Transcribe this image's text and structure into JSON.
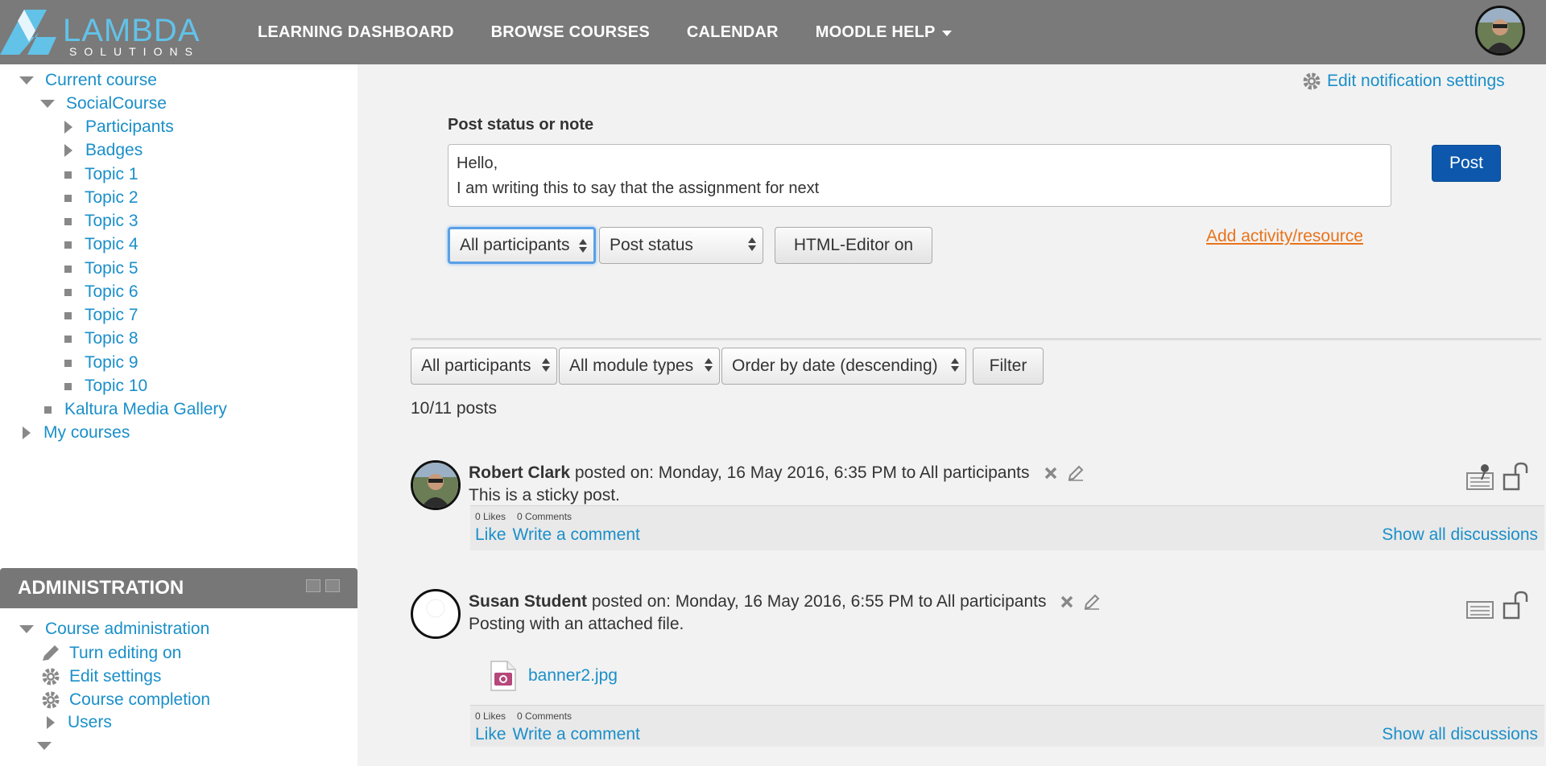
{
  "header": {
    "logo_word": "LAMBDA",
    "logo_sub": "SOLUTIONS",
    "nav": [
      {
        "label": "LEARNING DASHBOARD"
      },
      {
        "label": "BROWSE COURSES"
      },
      {
        "label": "CALENDAR"
      },
      {
        "label": "MOODLE HELP"
      }
    ]
  },
  "sidebar": {
    "current_course": "Current course",
    "course_name": "SocialCourse",
    "items": [
      {
        "label": "Participants"
      },
      {
        "label": "Badges"
      },
      {
        "label": "Topic 1"
      },
      {
        "label": "Topic 2"
      },
      {
        "label": "Topic 3"
      },
      {
        "label": "Topic 4"
      },
      {
        "label": "Topic 5"
      },
      {
        "label": "Topic 6"
      },
      {
        "label": "Topic 7"
      },
      {
        "label": "Topic 8"
      },
      {
        "label": "Topic 9"
      },
      {
        "label": "Topic 10"
      }
    ],
    "kaltura": "Kaltura Media Gallery",
    "my_courses": "My courses"
  },
  "admin": {
    "title": "ADMINISTRATION",
    "course_admin": "Course administration",
    "items": [
      {
        "label": "Turn editing on"
      },
      {
        "label": "Edit settings"
      },
      {
        "label": "Course completion"
      },
      {
        "label": "Users"
      }
    ]
  },
  "main": {
    "notification_link": "Edit notification settings",
    "post_label": "Post status or note",
    "post_text": "Hello,\nI am writing this to say that the assignment for next",
    "post_button": "Post",
    "audience_select": "All participants",
    "type_select": "Post status",
    "editor_button": "HTML-Editor on",
    "add_activity": "Add activity/resource",
    "filter": {
      "participants": "All participants",
      "modules": "All module types",
      "order": "Order by date (descending)",
      "button": "Filter"
    },
    "posts_count": "10/11 posts"
  },
  "posts": [
    {
      "author": "Robert Clark",
      "meta": "posted on: Monday, 16 May 2016, 6:35 PM to All participants",
      "body": "This is a sticky post.",
      "likes": "0 Likes",
      "comments": "0 Comments",
      "like_label": "Like",
      "comment_label": "Write a comment",
      "show_all": "Show all discussions"
    },
    {
      "author": "Susan Student",
      "meta": "posted on: Monday, 16 May 2016, 6:55 PM to All participants",
      "body": "Posting with an attached file.",
      "attachment": "banner2.jpg",
      "likes": "0 Likes",
      "comments": "0 Comments",
      "like_label": "Like",
      "comment_label": "Write a comment",
      "show_all": "Show all discussions"
    }
  ],
  "colors": {
    "header_bg": "#7a7a7a",
    "link": "#1a8fc9",
    "accent_orange": "#e8731a",
    "post_button": "#0d58ad"
  }
}
